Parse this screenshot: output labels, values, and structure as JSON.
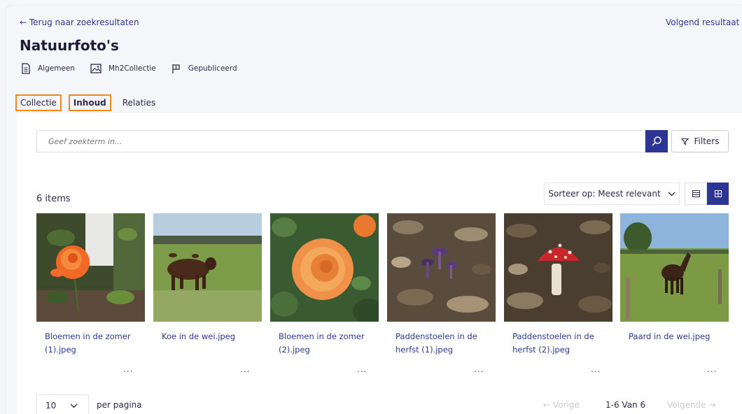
{
  "nav": {
    "back_label": "← Terug naar zoekresultaten",
    "next_label": "Volgend resultaat ›"
  },
  "page": {
    "title": "Natuurfoto's"
  },
  "meta": [
    {
      "icon": "document-icon",
      "label": "Algemeen"
    },
    {
      "icon": "image-icon",
      "label": "Mh2Collectie"
    },
    {
      "icon": "flag-icon",
      "label": "Gepubliceerd"
    }
  ],
  "tabs": [
    {
      "label": "Collectie",
      "highlighted": true
    },
    {
      "label": "Inhoud",
      "active": true,
      "highlighted": true
    },
    {
      "label": "Relaties"
    }
  ],
  "search": {
    "placeholder": "Geef zoekterm in...",
    "filters_label": "Filters"
  },
  "results": {
    "count_label": "6 items",
    "sort_label": "Sorteer op: Meest relevant",
    "view_mode": "grid"
  },
  "items": [
    {
      "caption": "Bloemen in de zomer (1).jpeg",
      "menu": "...",
      "image": "orange-rose"
    },
    {
      "caption": "Koe in de wei.jpeg",
      "menu": "...",
      "image": "cow-in-field"
    },
    {
      "caption": "Bloemen in de zomer (2).jpeg",
      "menu": "...",
      "image": "orange-rose-closeup"
    },
    {
      "caption": "Paddenstoelen in de herfst (1).jpeg",
      "menu": "...",
      "image": "purple-mushrooms"
    },
    {
      "caption": "Paddenstoelen in de herfst (2).jpeg",
      "menu": "...",
      "image": "fly-agaric"
    },
    {
      "caption": "Paard in de wei.jpeg",
      "menu": "...",
      "image": "horse-in-field"
    }
  ],
  "pagination": {
    "per_page_value": "10",
    "per_page_label": "per pagina",
    "prev_label": "← Vorige",
    "info": "1-6 Van 6",
    "next_label": "Volgende →"
  },
  "colors": {
    "primary": "#2c3594",
    "link": "#2b3a8c",
    "highlight": "#f08a1c",
    "background": "#f5f6fa"
  }
}
